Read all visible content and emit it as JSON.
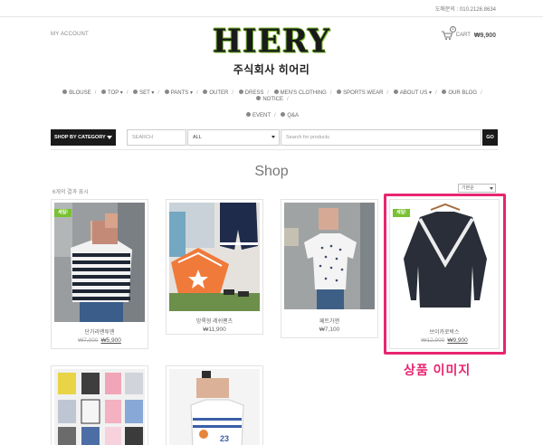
{
  "topbar": {
    "phone": "도매문의 : 010.2126.8634"
  },
  "header": {
    "my_account": "MY ACCOUNT",
    "logo_text": "HIERY",
    "logo_sub": "주식회사 히어리",
    "cart_label": "CART",
    "cart_total": "₩9,900",
    "cart_count": "1"
  },
  "nav": {
    "row1": [
      {
        "label": "BLOUSE",
        "icon": "info-icon"
      },
      {
        "label": "TOP ▾",
        "icon": "info-icon"
      },
      {
        "label": "SET ▾",
        "icon": "info-icon"
      },
      {
        "label": "PANTS ▾",
        "icon": "info-icon"
      },
      {
        "label": "OUTER",
        "icon": "info-icon"
      },
      {
        "label": "DRESS",
        "icon": "info-icon"
      },
      {
        "label": "MEN'S CLOTHING",
        "icon": "info-icon"
      },
      {
        "label": "SPORTS WEAR",
        "icon": "info-icon"
      },
      {
        "label": "ABOUT US ▾",
        "icon": "user-icon"
      },
      {
        "label": "OUR BLOG",
        "icon": "chat-icon"
      },
      {
        "label": "NOTICE",
        "icon": "exclamation-icon"
      }
    ],
    "row2": [
      {
        "label": "EVENT",
        "icon": "megaphone-icon"
      },
      {
        "label": "Q&A",
        "icon": "question-icon"
      }
    ]
  },
  "search": {
    "shop_by": "SHOP BY CATEGORY",
    "label": "SEARCH",
    "category": "ALL",
    "placeholder": "Search for products",
    "go": "GO"
  },
  "shop": {
    "title": "Shop",
    "result_count": "6개의 결과 표시",
    "sort": "기본순"
  },
  "products": [
    {
      "name": "단가라맨투맨",
      "old_price": "₩7,000",
      "price": "₩5,900",
      "sale": "세일!"
    },
    {
      "name": "망록형 레쉬팬츠",
      "price": "₩11,900"
    },
    {
      "name": "페트가앤",
      "price": "₩7,100"
    },
    {
      "name": "브이카로박스",
      "old_price": "₩12,900",
      "price": "₩9,900",
      "sale": "세일!"
    }
  ],
  "annotation": {
    "label": "상품 이미지",
    "color": "#e8256f"
  },
  "colors": {
    "accent": "#79c132",
    "dark": "#1a1a1a",
    "annotation": "#e8256f"
  }
}
